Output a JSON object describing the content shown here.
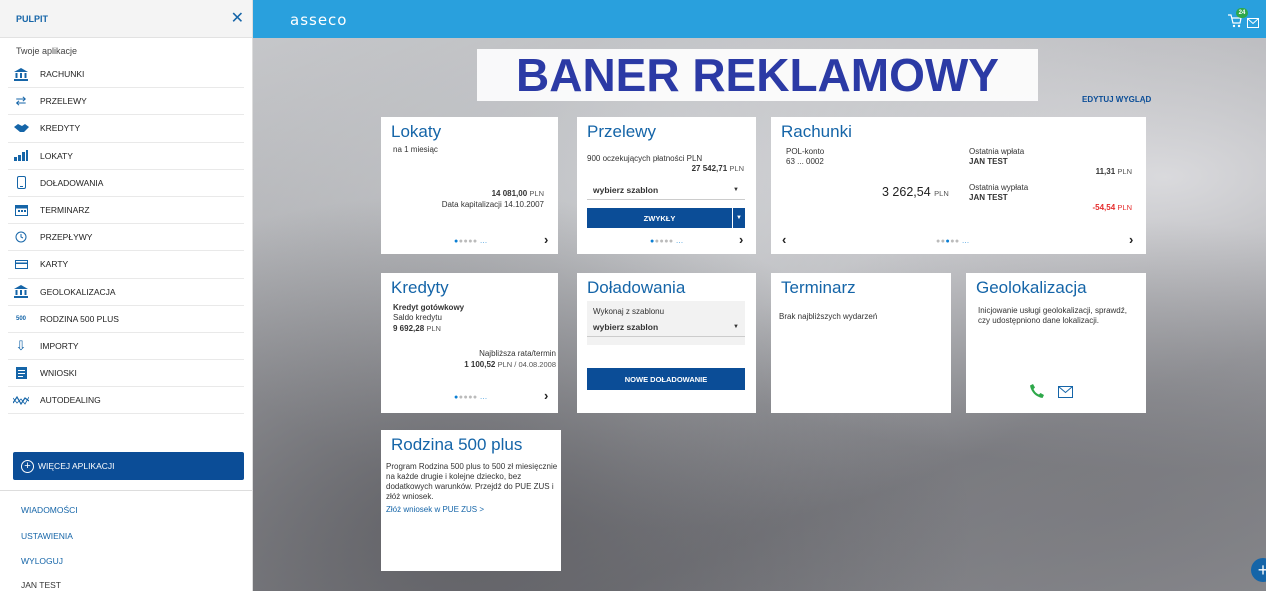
{
  "sidebar": {
    "title": "PULPIT",
    "subtitle": "Twoje aplikacje",
    "items": [
      {
        "label": "RACHUNKI",
        "icon": "bank-icon"
      },
      {
        "label": "PRZELEWY",
        "icon": "transfer-arrows-icon"
      },
      {
        "label": "KREDYTY",
        "icon": "handshake-icon"
      },
      {
        "label": "LOKATY",
        "icon": "bar-chart-icon"
      },
      {
        "label": "DOŁADOWANIA",
        "icon": "phone-icon"
      },
      {
        "label": "TERMINARZ",
        "icon": "calendar-icon"
      },
      {
        "label": "PRZEPŁYWY",
        "icon": "clock-icon"
      },
      {
        "label": "KARTY",
        "icon": "card-icon"
      },
      {
        "label": "GEOLOKALIZACJA",
        "icon": "bank-icon"
      },
      {
        "label": "RODZINA 500 PLUS",
        "icon": "rodzina-500-icon"
      },
      {
        "label": "IMPORTY",
        "icon": "import-icon"
      },
      {
        "label": "WNIOSKI",
        "icon": "document-icon"
      },
      {
        "label": "AUTODEALING",
        "icon": "chart-line-icon"
      }
    ],
    "more_button": "WIĘCEJ APLIKACJI",
    "footer": {
      "messages": "WIADOMOŚCI",
      "settings": "USTAWIENIA",
      "logout": "WYLOGUJ",
      "user": "JAN TEST"
    }
  },
  "header": {
    "logo": "asseco",
    "cart_badge": "24"
  },
  "banner": "BANER REKLAMOWY",
  "edit_look": "EDYTUJ WYGLĄD",
  "cards": {
    "lokaty": {
      "title": "Lokaty",
      "period": "na 1 miesiąc",
      "amount": "14 081,00",
      "currency": "PLN",
      "capitalization": "Data kapitalizacji 14.10.2007"
    },
    "przelewy": {
      "title": "Przelewy",
      "pending": "900 oczekujących płatności PLN",
      "amount": "27 542,71",
      "currency": "PLN",
      "template_select": "wybierz szablon",
      "button": "ZWYKŁY"
    },
    "rachunki": {
      "title": "Rachunki",
      "account_name": "POL-konto",
      "account_number": "63 ... 0002",
      "balance": "3 262,54",
      "currency": "PLN",
      "last_deposit_label": "Ostatnia wpłata",
      "last_deposit_name": "JAN TEST",
      "last_deposit_amount": "11,31",
      "last_withdrawal_label": "Ostatnia wypłata",
      "last_withdrawal_name": "JAN TEST",
      "last_withdrawal_amount": "-54,54"
    },
    "kredyty": {
      "title": "Kredyty",
      "type": "Kredyt gotówkowy",
      "balance_label": "Saldo kredytu",
      "balance": "9 692,28",
      "currency": "PLN",
      "next_label": "Najbliższa rata/termin",
      "next_amount": "1 100,52",
      "next_rest": "PLN / 04.08.2008"
    },
    "doladowania": {
      "title": "Doładowania",
      "template_label": "Wykonaj z szablonu",
      "template_select": "wybierz szablon",
      "button": "NOWE DOŁADOWANIE"
    },
    "terminarz": {
      "title": "Terminarz",
      "empty": "Brak najbliższych wydarzeń"
    },
    "geolokalizacja": {
      "title": "Geolokalizacja",
      "text": "Inicjowanie usługi geolokalizacji, sprawdź, czy udostępniono dane lokalizacji."
    },
    "rodzina": {
      "title": "Rodzina 500 plus",
      "text": "Program Rodzina 500 plus to 500 zł miesięcznie na każde drugie i kolejne dziecko, bez dodatkowych warunków. Przejdź do PUE ZUS i złóż wniosek.",
      "link": "Złóż wniosek w PUE ZUS >"
    }
  },
  "colors": {
    "topbar": "#29a0dd",
    "primary": "#0b4d97",
    "title_blue": "#1565a8",
    "banner_text": "#2b3aa5",
    "negative": "#e52c2c",
    "phone_green": "#2ea84a"
  }
}
